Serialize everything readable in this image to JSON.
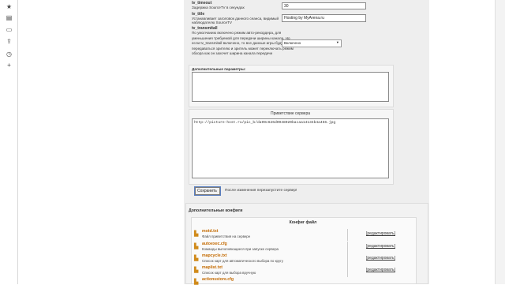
{
  "sidebar": {
    "icons": [
      "star-icon",
      "notes-icon",
      "monitor-icon",
      "share-icon",
      "clock-icon",
      "add-icon"
    ]
  },
  "settings": {
    "tv_timeout": {
      "name": "tv_timeout",
      "desc": "Задержка SourceTV в секундах",
      "value": "30"
    },
    "tv_title": {
      "name": "tv_title",
      "desc": "Устанавливает заголовок данного сеанса, видимый наблюдателю SourceTV",
      "value": "Hosting by MyArena.ru"
    },
    "tv_transmitall": {
      "name": "tv_transmitall",
      "desc": "По умолчанию включено режим авто-рекордера, для уменьшения требуемой для передачи ширины канала. Но если tv_transmitall включено, то все данные игры будут передаваться зрителю и зритель может переключать режим обзора как он захочет ширина канала передачи",
      "value": "Включено"
    },
    "extra_params": {
      "label": "Дополнительные параметры:"
    },
    "greeting": {
      "label": "Приветствие сервера",
      "value": "http://picture-host.ru/pic_b/da99c626d0948020bacaa14134b4a456.jpg"
    },
    "save": {
      "button": "Сохранить",
      "note": "После изменения перезапустите сервер!"
    }
  },
  "configs": {
    "title": "Дополнительные конфиги",
    "column": "Конфиг файл",
    "edit_label": "[редактировать]",
    "files": [
      {
        "name": "motd.txt",
        "desc": "Файл приветствия на сервере"
      },
      {
        "name": "autoexec.cfg",
        "desc": "Команды выполняющиеся при запуске сервера"
      },
      {
        "name": "mapcycle.txt",
        "desc": "Список карт для автоматического выбора по кругу"
      },
      {
        "name": "maplist.txt",
        "desc": "Список карт для выбора вручную"
      },
      {
        "name": "actionsstore.cfg",
        "desc": ""
      }
    ]
  }
}
